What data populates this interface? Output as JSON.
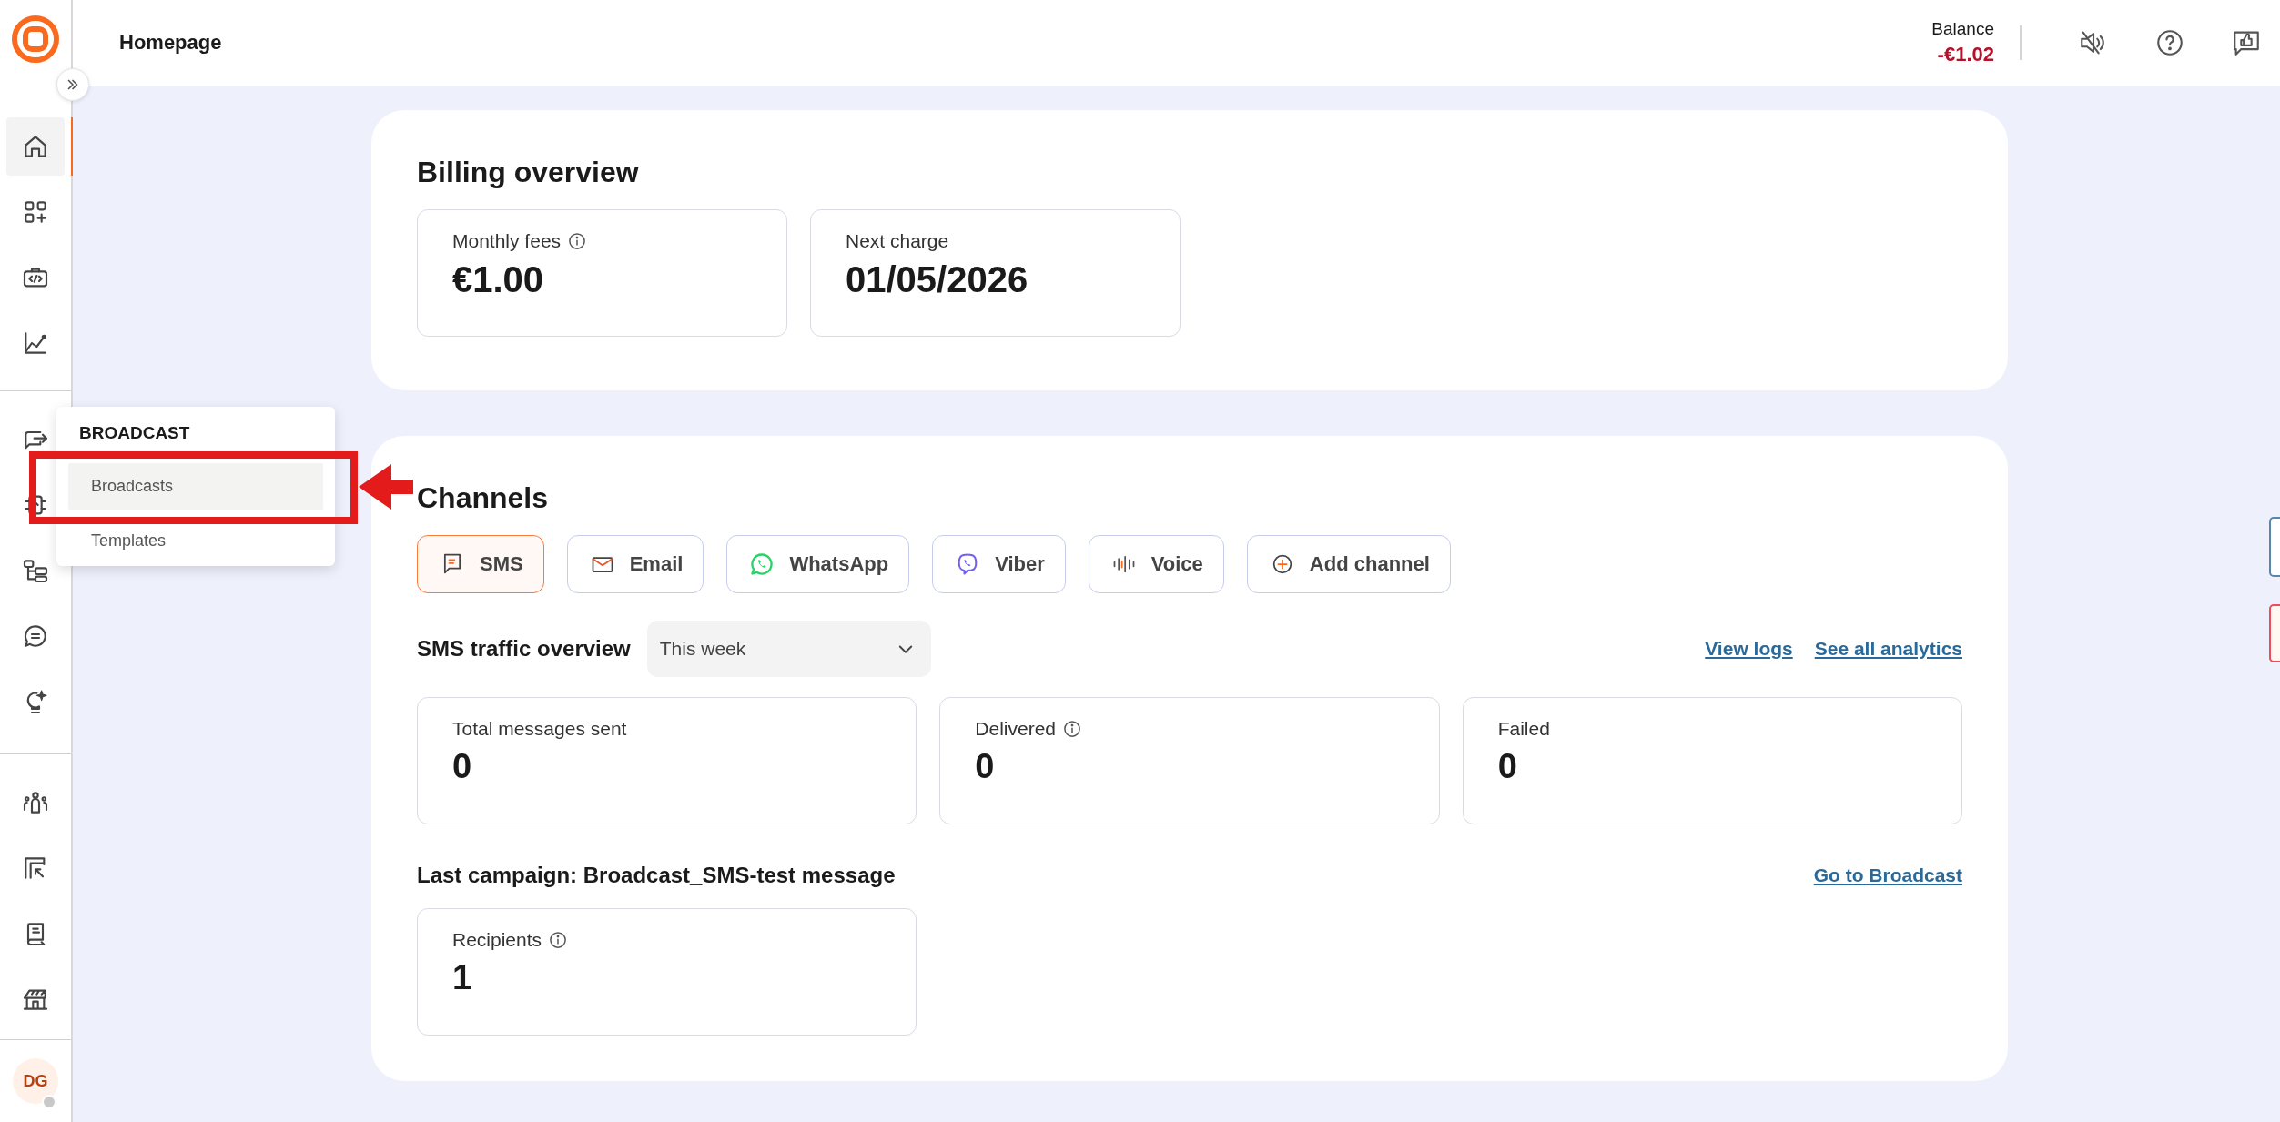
{
  "header": {
    "title": "Homepage",
    "balance_label": "Balance",
    "balance_value": "-€1.02"
  },
  "sidebar": {
    "groups": [
      {
        "items": [
          {
            "kind": "home",
            "selected": true
          },
          {
            "kind": "apps",
            "selected": false
          },
          {
            "kind": "code",
            "selected": false
          },
          {
            "kind": "chart",
            "selected": false
          }
        ]
      },
      {
        "items": [
          {
            "kind": "broadcast",
            "selected": false
          },
          {
            "kind": "chip",
            "selected": false
          },
          {
            "kind": "flow",
            "selected": false
          },
          {
            "kind": "chat",
            "selected": false
          },
          {
            "kind": "bulb",
            "selected": false
          }
        ]
      },
      {
        "items": [
          {
            "kind": "people",
            "selected": false
          },
          {
            "kind": "import",
            "selected": false
          },
          {
            "kind": "book",
            "selected": false
          },
          {
            "kind": "store",
            "selected": false
          }
        ]
      }
    ],
    "avatar": "DG"
  },
  "popup": {
    "heading": "BROADCAST",
    "items": [
      {
        "label": "Broadcasts",
        "selected": true
      },
      {
        "label": "Templates",
        "selected": false
      }
    ]
  },
  "billing": {
    "title": "Billing overview",
    "cards": [
      {
        "label": "Monthly fees",
        "info": true,
        "value": "€1.00"
      },
      {
        "label": "Next charge",
        "info": false,
        "value": "01/05/2026"
      }
    ]
  },
  "channels": {
    "title": "Channels",
    "buttons": [
      {
        "label": "SMS",
        "kind": "sms",
        "selected": true
      },
      {
        "label": "Email",
        "kind": "email",
        "selected": false
      },
      {
        "label": "WhatsApp",
        "kind": "whatsapp",
        "selected": false
      },
      {
        "label": "Viber",
        "kind": "viber",
        "selected": false
      },
      {
        "label": "Voice",
        "kind": "voice",
        "selected": false
      },
      {
        "label": "Add channel",
        "kind": "add",
        "selected": false
      }
    ]
  },
  "traffic": {
    "title": "SMS traffic overview",
    "period": "This week",
    "links": [
      "View logs",
      "See all analytics"
    ],
    "stats": [
      {
        "label": "Total messages sent",
        "info": false,
        "value": "0"
      },
      {
        "label": "Delivered",
        "info": true,
        "value": "0"
      },
      {
        "label": "Failed",
        "info": false,
        "value": "0"
      }
    ]
  },
  "campaign": {
    "title": "Last campaign: Broadcast_SMS-test message",
    "link": "Go to Broadcast",
    "stats": [
      {
        "label": "Recipients",
        "info": true,
        "value": "1"
      }
    ]
  }
}
